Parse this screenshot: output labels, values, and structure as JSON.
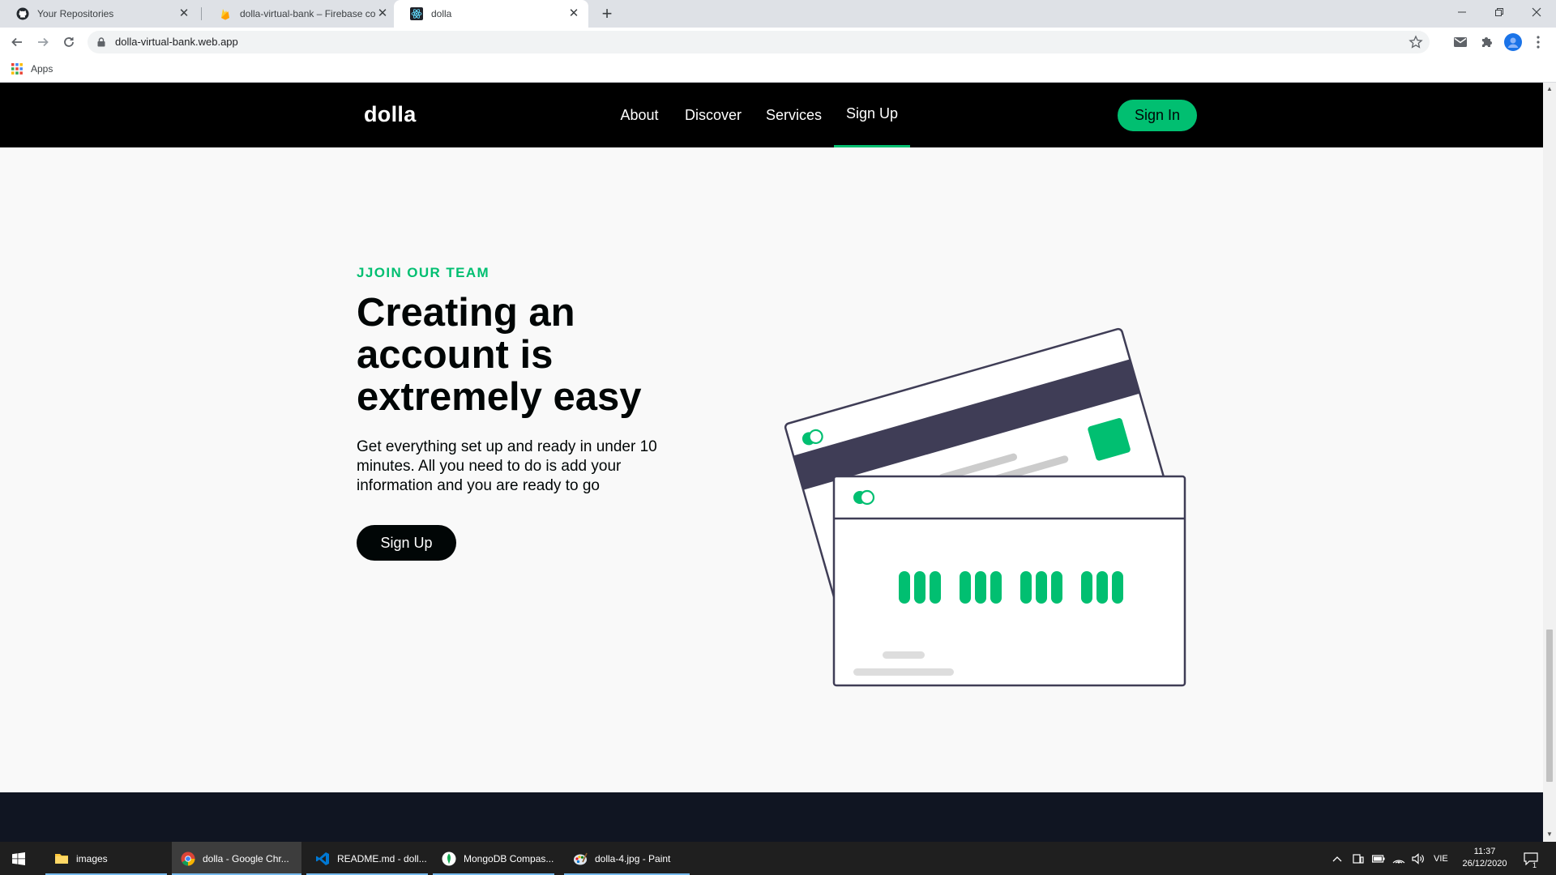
{
  "browser": {
    "tabs": [
      {
        "title": "Your Repositories",
        "icon": "github-icon"
      },
      {
        "title": "dolla-virtual-bank – Firebase con",
        "icon": "firebase-icon"
      },
      {
        "title": "dolla",
        "icon": "react-icon"
      }
    ],
    "url": "dolla-virtual-bank.web.app",
    "bookmarks": {
      "apps_label": "Apps"
    }
  },
  "site": {
    "logo": "dolla",
    "menu": [
      "About",
      "Discover",
      "Services",
      "Sign Up"
    ],
    "active_menu": "Sign Up",
    "signin_label": "Sign In",
    "brand_color": "#01bf71",
    "nav_bg": "#000000"
  },
  "hero": {
    "topline": "JJOIN OUR TEAM",
    "heading": "Creating an account is extremely easy",
    "subtitle": "Get everything set up and ready in under 10 minutes. All you need to do is add your information and you are ready to go",
    "button_label": "Sign Up",
    "illustration": "credit-cards-illustration"
  },
  "taskbar": {
    "items": [
      {
        "label": "images",
        "icon": "folder-icon"
      },
      {
        "label": "dolla - Google Chr...",
        "icon": "chrome-icon",
        "active": true
      },
      {
        "label": "README.md - doll...",
        "icon": "vscode-icon"
      },
      {
        "label": "MongoDB Compas...",
        "icon": "mongodb-icon"
      },
      {
        "label": "dolla-4.jpg - Paint",
        "icon": "paint-icon"
      }
    ],
    "language": "VIE",
    "time": "11:37",
    "date": "26/12/2020",
    "notifications": "1"
  }
}
